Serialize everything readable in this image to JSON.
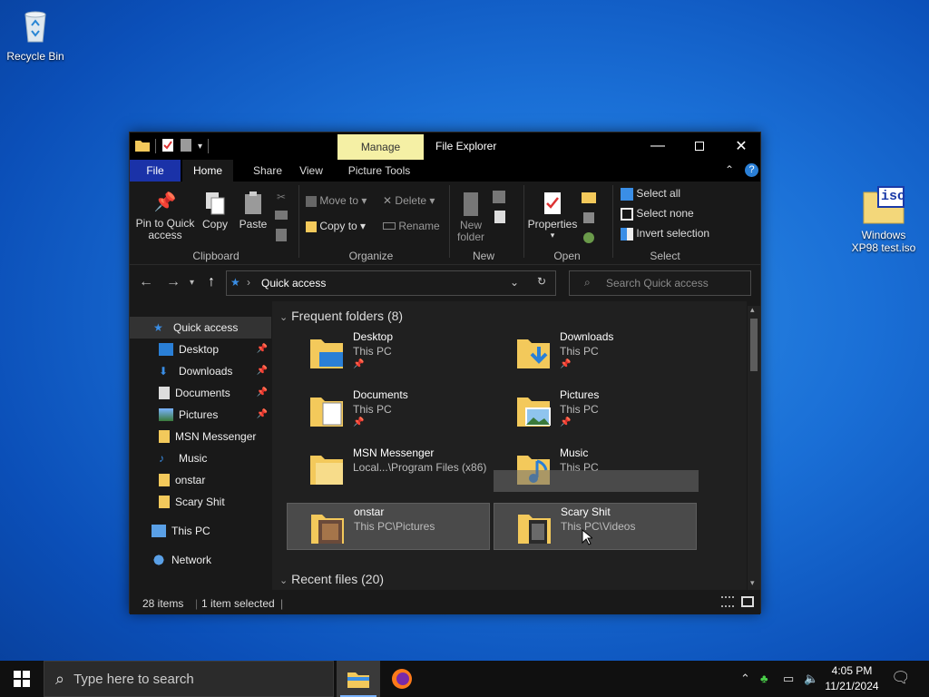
{
  "desktop": {
    "recycle_bin_label": "Recycle Bin",
    "iso_label": "Windows XP98 test.iso",
    "iso_badge": "iso"
  },
  "explorer": {
    "title": "File Explorer",
    "manage_label": "Manage",
    "tabs": [
      "File",
      "Home",
      "Share",
      "View",
      "Picture Tools"
    ],
    "ribbon": {
      "pin_label": "Pin to Quick access",
      "copy_label": "Copy",
      "paste_label": "Paste",
      "clipboard_group": "Clipboard",
      "move_to": "Move to",
      "copy_to": "Copy to",
      "delete": "Delete",
      "rename": "Rename",
      "organize_group": "Organize",
      "new_folder": "New folder",
      "new_group": "New",
      "properties": "Properties",
      "open_group": "Open",
      "select_all": "Select all",
      "select_none": "Select none",
      "invert_selection": "Invert selection",
      "select_group": "Select"
    },
    "address": {
      "location": "Quick access",
      "search_placeholder": "Search Quick access"
    },
    "nav": [
      {
        "label": "Quick access",
        "pinned": false
      },
      {
        "label": "Desktop",
        "pinned": true
      },
      {
        "label": "Downloads",
        "pinned": true
      },
      {
        "label": "Documents",
        "pinned": true
      },
      {
        "label": "Pictures",
        "pinned": true
      },
      {
        "label": "MSN Messenger",
        "pinned": false
      },
      {
        "label": "Music",
        "pinned": false
      },
      {
        "label": "onstar",
        "pinned": false
      },
      {
        "label": "Scary Shit",
        "pinned": false
      },
      {
        "label": "This PC",
        "pinned": false
      },
      {
        "label": "Network",
        "pinned": false
      }
    ],
    "frequent_header": "Frequent folders (8)",
    "recent_header": "Recent files (20)",
    "folders": [
      {
        "name": "Desktop",
        "path": "This PC",
        "pinned": true
      },
      {
        "name": "Downloads",
        "path": "This PC",
        "pinned": true
      },
      {
        "name": "Documents",
        "path": "This PC",
        "pinned": true
      },
      {
        "name": "Pictures",
        "path": "This PC",
        "pinned": true
      },
      {
        "name": "MSN Messenger",
        "path": "Local...\\Program Files (x86)",
        "pinned": false
      },
      {
        "name": "Music",
        "path": "This PC",
        "pinned": false
      },
      {
        "name": "onstar",
        "path": "This PC\\Pictures",
        "pinned": false
      },
      {
        "name": "Scary Shit",
        "path": "This PC\\Videos",
        "pinned": false
      }
    ],
    "status": {
      "items": "28 items",
      "selected": "1 item selected"
    }
  },
  "taskbar": {
    "search_placeholder": "Type here to search",
    "time": "4:05 PM",
    "date": "11/21/2024"
  },
  "colors": {
    "file_tab": "#1a32a8",
    "manage_tab": "#f5f0a5",
    "folder_yellow": "#f3c95b"
  }
}
